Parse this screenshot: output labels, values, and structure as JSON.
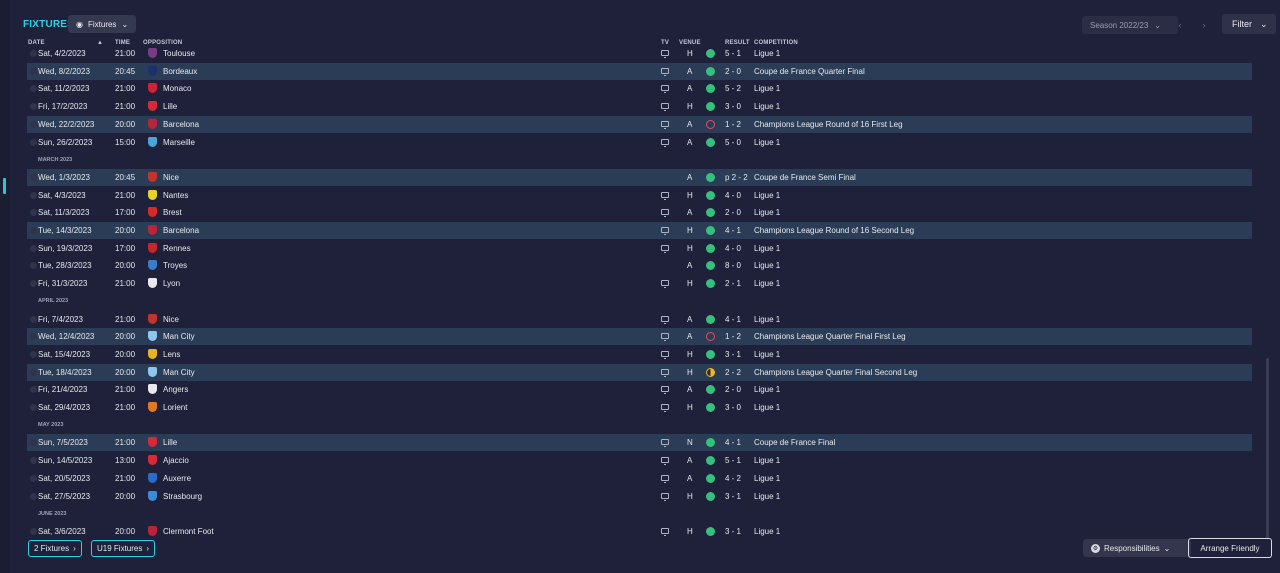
{
  "header": {
    "title": "FIXTURES",
    "view_button": "Fixtures",
    "season": "Season 2022/23",
    "filter": "Filter"
  },
  "columns": {
    "date": "DATE",
    "time": "TIME",
    "opposition": "OPPOSITION",
    "tv": "TV",
    "venue": "VENUE",
    "result": "RESULT",
    "competition": "COMPETITION"
  },
  "rows": [
    {
      "kind": "match",
      "date": "Sat, 4/2/2023",
      "time": "21:00",
      "opp": "Toulouse",
      "venue": "H",
      "outcome": "win",
      "result": "5 - 1",
      "comp": "Ligue 1",
      "tv": true,
      "hl": false,
      "crest": "#7a3b86"
    },
    {
      "kind": "match",
      "date": "Wed, 8/2/2023",
      "time": "20:45",
      "opp": "Bordeaux",
      "venue": "A",
      "outcome": "win",
      "result": "2 - 0",
      "comp": "Coupe de France Quarter Final",
      "tv": true,
      "hl": true,
      "crest": "#1d2f6e"
    },
    {
      "kind": "match",
      "date": "Sat, 11/2/2023",
      "time": "21:00",
      "opp": "Monaco",
      "venue": "A",
      "outcome": "win",
      "result": "5 - 2",
      "comp": "Ligue 1",
      "tv": true,
      "hl": false,
      "crest": "#d0213a"
    },
    {
      "kind": "match",
      "date": "Fri, 17/2/2023",
      "time": "21:00",
      "opp": "Lille",
      "venue": "H",
      "outcome": "win",
      "result": "3 - 0",
      "comp": "Ligue 1",
      "tv": true,
      "hl": false,
      "crest": "#d8293a"
    },
    {
      "kind": "match",
      "date": "Wed, 22/2/2023",
      "time": "20:00",
      "opp": "Barcelona",
      "venue": "A",
      "outcome": "loss",
      "result": "1 - 2",
      "comp": "Champions League Round of 16  First Leg",
      "tv": true,
      "hl": true,
      "crest": "#b8243a"
    },
    {
      "kind": "match",
      "date": "Sun, 26/2/2023",
      "time": "15:00",
      "opp": "Marseille",
      "venue": "A",
      "outcome": "win",
      "result": "5 - 0",
      "comp": "Ligue 1",
      "tv": true,
      "hl": false,
      "crest": "#4aa6d8"
    },
    {
      "kind": "month",
      "label": "MARCH 2023"
    },
    {
      "kind": "match",
      "date": "Wed, 1/3/2023",
      "time": "20:45",
      "opp": "Nice",
      "venue": "A",
      "outcome": "win",
      "result": "p 2 - 2",
      "comp": "Coupe de France Semi Final",
      "tv": false,
      "hl": true,
      "crest": "#c2332a"
    },
    {
      "kind": "match",
      "date": "Sat, 4/3/2023",
      "time": "21:00",
      "opp": "Nantes",
      "venue": "H",
      "outcome": "win",
      "result": "4 - 0",
      "comp": "Ligue 1",
      "tv": true,
      "hl": false,
      "crest": "#e8d22a"
    },
    {
      "kind": "match",
      "date": "Sat, 11/3/2023",
      "time": "17:00",
      "opp": "Brest",
      "venue": "A",
      "outcome": "win",
      "result": "2 - 0",
      "comp": "Ligue 1",
      "tv": true,
      "hl": false,
      "crest": "#d62a2a"
    },
    {
      "kind": "match",
      "date": "Tue, 14/3/2023",
      "time": "20:00",
      "opp": "Barcelona",
      "venue": "H",
      "outcome": "win",
      "result": "4 - 1",
      "comp": "Champions League Round of 16  Second Leg",
      "tv": true,
      "hl": true,
      "crest": "#b8243a"
    },
    {
      "kind": "match",
      "date": "Sun, 19/3/2023",
      "time": "17:00",
      "opp": "Rennes",
      "venue": "H",
      "outcome": "win",
      "result": "4 - 0",
      "comp": "Ligue 1",
      "tv": true,
      "hl": false,
      "crest": "#c8262c"
    },
    {
      "kind": "match",
      "date": "Tue, 28/3/2023",
      "time": "20:00",
      "opp": "Troyes",
      "venue": "A",
      "outcome": "win",
      "result": "8 - 0",
      "comp": "Ligue 1",
      "tv": false,
      "hl": false,
      "crest": "#3b7bc8"
    },
    {
      "kind": "match",
      "date": "Fri, 31/3/2023",
      "time": "21:00",
      "opp": "Lyon",
      "venue": "H",
      "outcome": "win",
      "result": "2 - 1",
      "comp": "Ligue 1",
      "tv": true,
      "hl": false,
      "crest": "#e8e8ee"
    },
    {
      "kind": "month",
      "label": "APRIL 2023"
    },
    {
      "kind": "match",
      "date": "Fri, 7/4/2023",
      "time": "21:00",
      "opp": "Nice",
      "venue": "A",
      "outcome": "win",
      "result": "4 - 1",
      "comp": "Ligue 1",
      "tv": true,
      "hl": false,
      "crest": "#c2332a"
    },
    {
      "kind": "match",
      "date": "Wed, 12/4/2023",
      "time": "20:00",
      "opp": "Man City",
      "venue": "A",
      "outcome": "loss",
      "result": "1 - 2",
      "comp": "Champions League Quarter Final First Leg",
      "tv": true,
      "hl": true,
      "crest": "#8ec6ee"
    },
    {
      "kind": "match",
      "date": "Sat, 15/4/2023",
      "time": "20:00",
      "opp": "Lens",
      "venue": "H",
      "outcome": "win",
      "result": "3 - 1",
      "comp": "Ligue 1",
      "tv": true,
      "hl": false,
      "crest": "#e8b322"
    },
    {
      "kind": "match",
      "date": "Tue, 18/4/2023",
      "time": "20:00",
      "opp": "Man City",
      "venue": "H",
      "outcome": "draw",
      "result": "2 - 2",
      "comp": "Champions League Quarter Final Second Leg",
      "tv": true,
      "hl": true,
      "crest": "#8ec6ee"
    },
    {
      "kind": "match",
      "date": "Fri, 21/4/2023",
      "time": "21:00",
      "opp": "Angers",
      "venue": "A",
      "outcome": "win",
      "result": "2 - 0",
      "comp": "Ligue 1",
      "tv": true,
      "hl": false,
      "crest": "#e8e8ee"
    },
    {
      "kind": "match",
      "date": "Sat, 29/4/2023",
      "time": "21:00",
      "opp": "Lorient",
      "venue": "H",
      "outcome": "win",
      "result": "3 - 0",
      "comp": "Ligue 1",
      "tv": true,
      "hl": false,
      "crest": "#e07a22"
    },
    {
      "kind": "month",
      "label": "MAY 2023"
    },
    {
      "kind": "match",
      "date": "Sun, 7/5/2023",
      "time": "21:00",
      "opp": "Lille",
      "venue": "N",
      "outcome": "win",
      "result": "4 - 1",
      "comp": "Coupe de France Final",
      "tv": true,
      "hl": true,
      "crest": "#d8293a"
    },
    {
      "kind": "match",
      "date": "Sun, 14/5/2023",
      "time": "13:00",
      "opp": "Ajaccio",
      "venue": "A",
      "outcome": "win",
      "result": "5 - 1",
      "comp": "Ligue 1",
      "tv": true,
      "hl": false,
      "crest": "#d8293a"
    },
    {
      "kind": "match",
      "date": "Sat, 20/5/2023",
      "time": "21:00",
      "opp": "Auxerre",
      "venue": "A",
      "outcome": "win",
      "result": "4 - 2",
      "comp": "Ligue 1",
      "tv": true,
      "hl": false,
      "crest": "#2a6ac8"
    },
    {
      "kind": "match",
      "date": "Sat, 27/5/2023",
      "time": "20:00",
      "opp": "Strasbourg",
      "venue": "H",
      "outcome": "win",
      "result": "3 - 1",
      "comp": "Ligue 1",
      "tv": true,
      "hl": false,
      "crest": "#3a8ad8"
    },
    {
      "kind": "month",
      "label": "JUNE 2023"
    },
    {
      "kind": "match",
      "date": "Sat, 3/6/2023",
      "time": "20:00",
      "opp": "Clermont Foot",
      "venue": "H",
      "outcome": "win",
      "result": "3 - 1",
      "comp": "Ligue 1",
      "tv": true,
      "hl": false,
      "crest": "#b8243a"
    }
  ],
  "footer": {
    "link1": "2 Fixtures",
    "link2": "U19 Fixtures",
    "responsibilities": "Responsibilities",
    "arrange": "Arrange Friendly"
  },
  "colors": {
    "accent": "#2fd0e6",
    "win": "#35c07d",
    "loss": "#e0505a",
    "draw": "#f2b622",
    "highlight_row": "#2b3d56"
  }
}
